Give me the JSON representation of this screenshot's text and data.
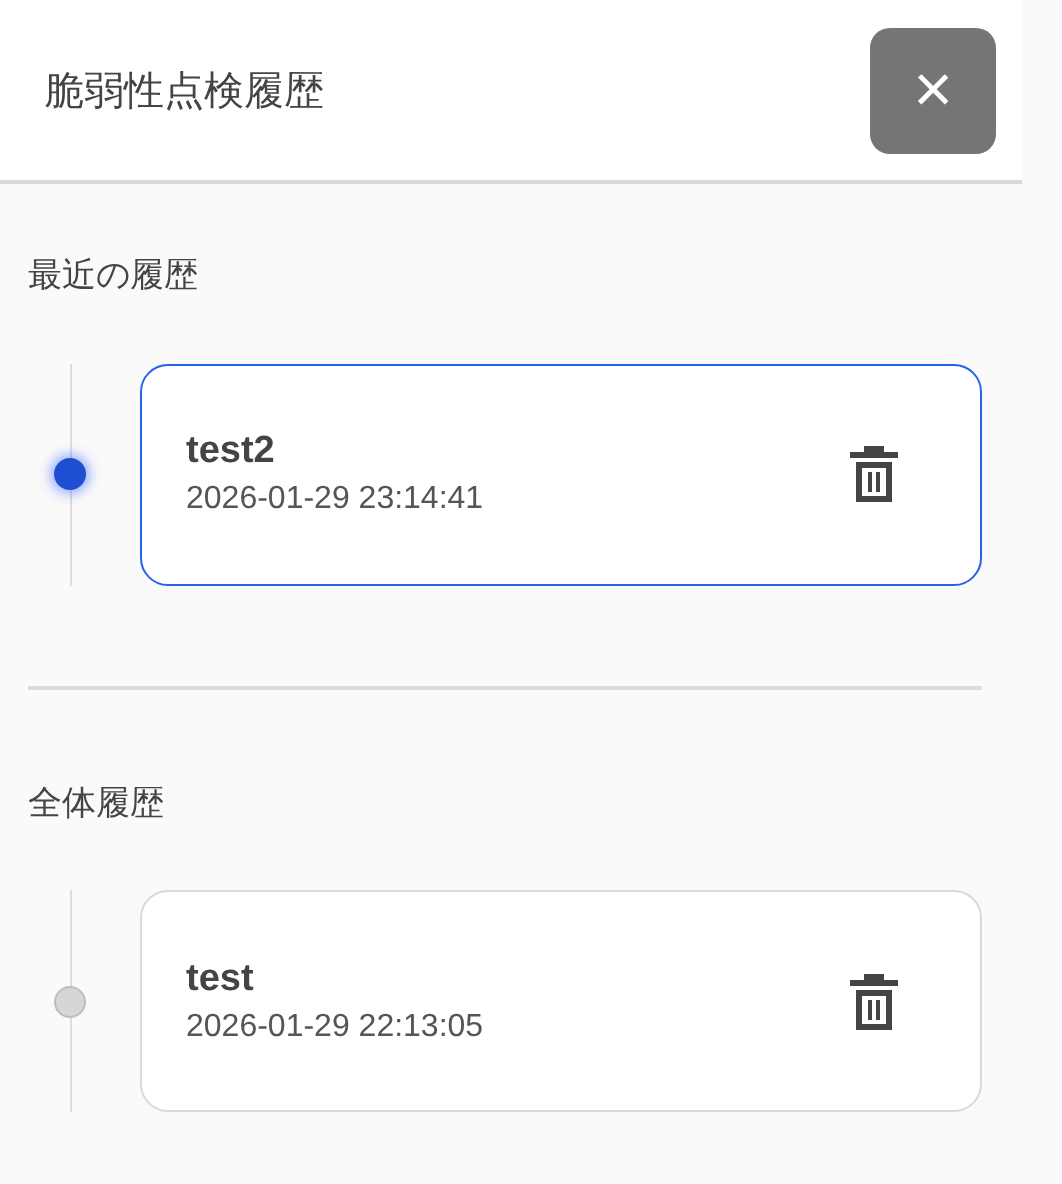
{
  "header": {
    "title": "脆弱性点検履歴",
    "close_label": "×"
  },
  "sections": [
    {
      "title": "最近の履歴",
      "items": [
        {
          "name": "test2",
          "timestamp": "2026-01-29 23:14:41",
          "selected": true
        }
      ]
    },
    {
      "title": "全体履歴",
      "items": [
        {
          "name": "test",
          "timestamp": "2026-01-29 22:13:05",
          "selected": false
        }
      ]
    }
  ]
}
